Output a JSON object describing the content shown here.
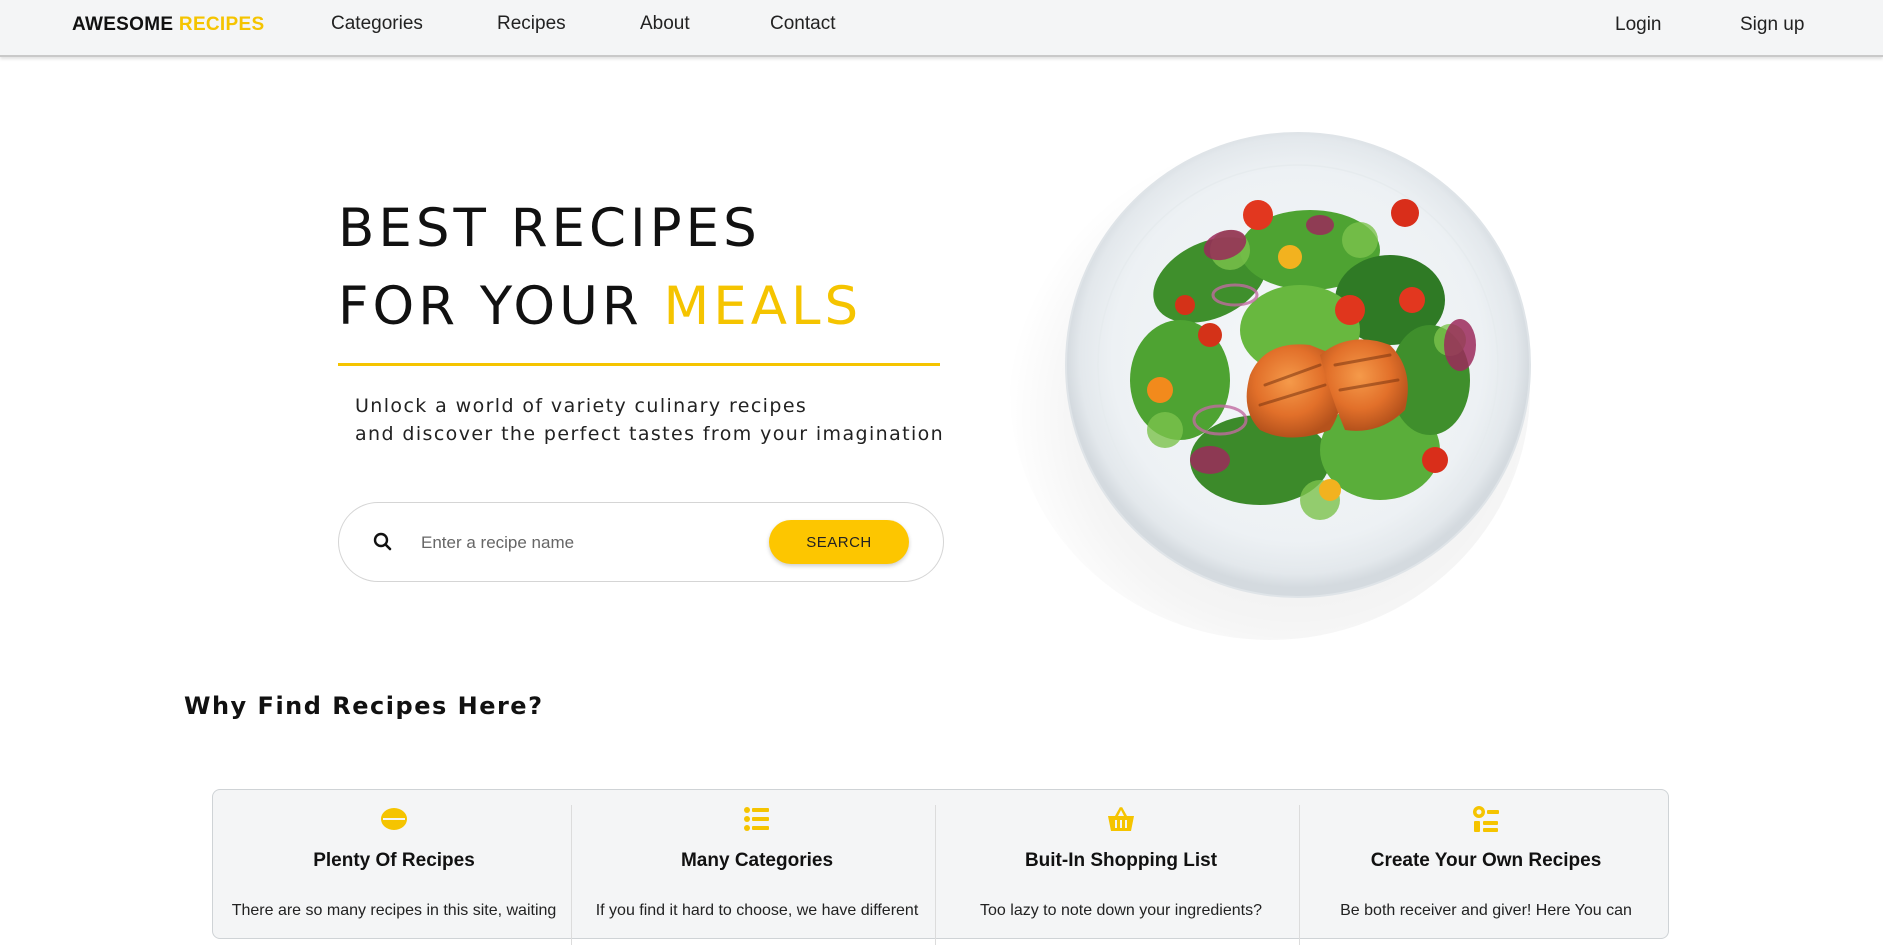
{
  "navbar": {
    "brand_part1": "AWESOME ",
    "brand_part2": "RECIPES",
    "links": [
      "Categories",
      "Recipes",
      "About",
      "Contact"
    ],
    "login": "Login",
    "signup": "Sign up"
  },
  "hero": {
    "title_line1": "BEST RECIPES",
    "title_line2_prefix": "FOR YOUR ",
    "title_line2_accent": "MEALS",
    "subtitle_line1": "Unlock a world of variety culinary recipes",
    "subtitle_line2": "and discover the perfect tastes from your imagination",
    "search_placeholder": "Enter a recipe name",
    "search_button": "SEARCH",
    "image": "salmon-salad-plate"
  },
  "why_section": {
    "title": "Why Find Recipes Here?",
    "features": [
      {
        "icon": "bowl-icon",
        "title": "Plenty Of Recipes",
        "text": "There are so many recipes in this site, waiting"
      },
      {
        "icon": "list-icon",
        "title": "Many Categories",
        "text": "If you find it hard to choose, we have different"
      },
      {
        "icon": "basket-icon",
        "title": "Buit-In Shopping List",
        "text": "Too lazy to note down your ingredients?"
      },
      {
        "icon": "recipe-tools-icon",
        "title": "Create Your Own Recipes",
        "text": "Be both receiver and giver! Here You can"
      }
    ]
  },
  "colors": {
    "accent": "#f5c400",
    "button": "#fdc600",
    "navbar_bg": "#f4f5f6",
    "card_bg": "#f4f5f6"
  }
}
